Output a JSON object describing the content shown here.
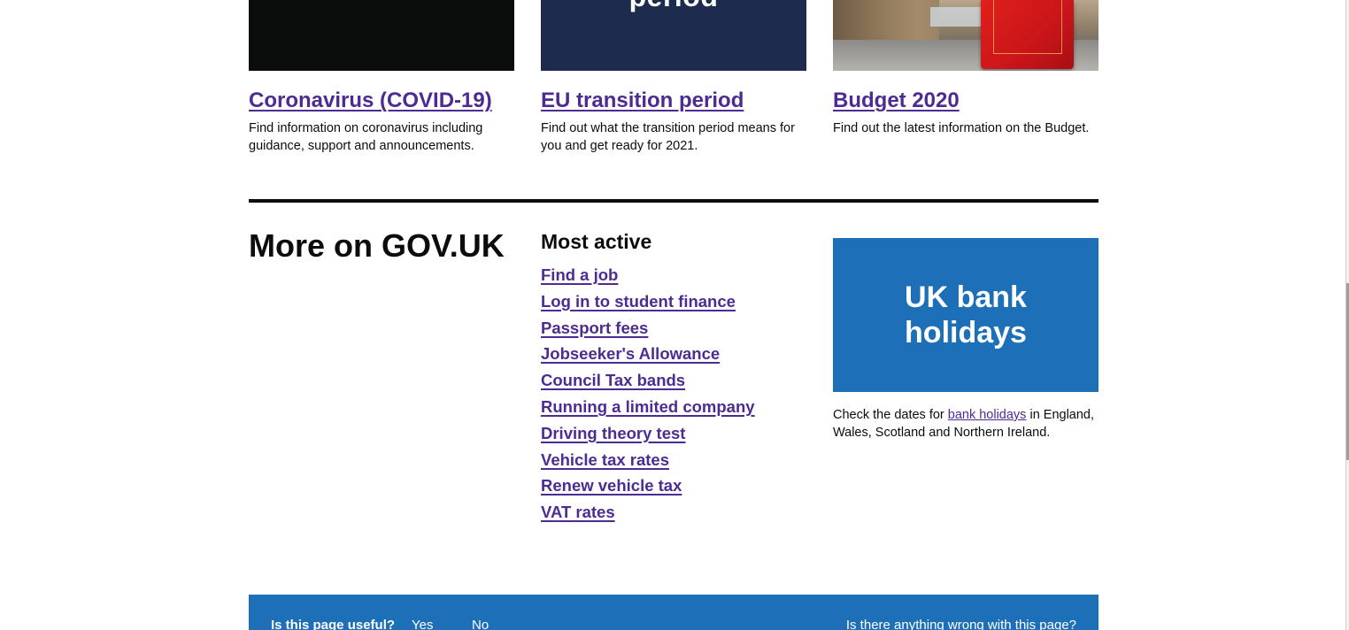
{
  "promos": [
    {
      "image_text": "",
      "title": "Coronavirus (COVID-19)",
      "description": "Find information on coronavirus including guidance, support and announcements."
    },
    {
      "image_text": "period",
      "title": "EU transition period",
      "description": "Find out what the transition period means for you and get ready for 2021."
    },
    {
      "image_text": "",
      "title": "Budget 2020",
      "description": "Find out the latest information on the Budget."
    }
  ],
  "more": {
    "heading": "More on GOV.UK"
  },
  "most_active": {
    "heading": "Most active",
    "links": [
      "Find a job",
      "Log in to student finance",
      "Passport fees",
      "Jobseeker's Allowance",
      "Council Tax bands",
      "Running a limited company",
      "Driving theory test",
      "Vehicle tax rates",
      "Renew vehicle tax",
      "VAT rates"
    ]
  },
  "bank_holidays": {
    "title": "UK bank holidays",
    "text_before": "Check the dates for ",
    "link": "bank holidays",
    "text_after": " in England, Wales, Scotland and Northern Ireland."
  },
  "feedback": {
    "question": "Is this page useful?",
    "yes": "Yes",
    "no": "No",
    "report": "Is there anything wrong with this page?"
  },
  "colors": {
    "link": "#4c2c92",
    "brand_blue": "#1d70b8",
    "navy": "#1d2c4e",
    "text": "#0b0c0c"
  }
}
